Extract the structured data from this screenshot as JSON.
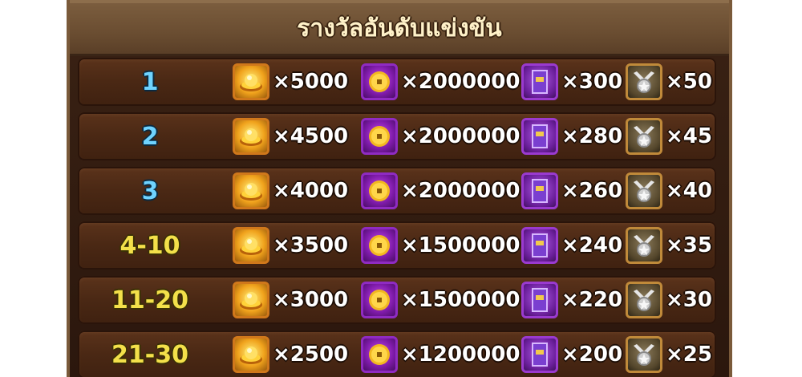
{
  "title": "รางวัลอันดับแข่งขัน",
  "reward_icons": [
    "gold-ingot-icon",
    "purple-coin-icon",
    "purple-ticket-icon",
    "medal-icon"
  ],
  "rows": [
    {
      "rank": "1",
      "gold": "×5000",
      "coin": "×2000000",
      "ticket": "×300",
      "medal": "×50"
    },
    {
      "rank": "2",
      "gold": "×4500",
      "coin": "×2000000",
      "ticket": "×280",
      "medal": "×45"
    },
    {
      "rank": "3",
      "gold": "×4000",
      "coin": "×2000000",
      "ticket": "×260",
      "medal": "×40"
    },
    {
      "rank": "4-10",
      "gold": "×3500",
      "coin": "×1500000",
      "ticket": "×240",
      "medal": "×35"
    },
    {
      "rank": "11-20",
      "gold": "×3000",
      "coin": "×1500000",
      "ticket": "×220",
      "medal": "×30"
    },
    {
      "rank": "21-30",
      "gold": "×2500",
      "coin": "×1200000",
      "ticket": "×200",
      "medal": "×25"
    }
  ]
}
